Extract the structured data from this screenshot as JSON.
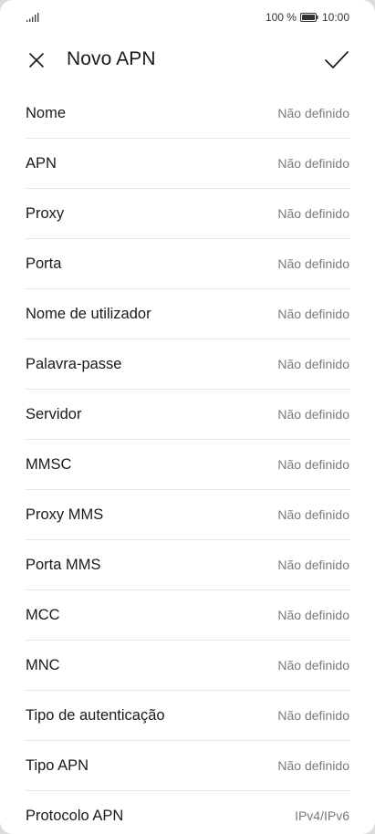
{
  "status_bar": {
    "battery_percent": "100 %",
    "time": "10:00"
  },
  "header": {
    "title": "Novo APN"
  },
  "fields": [
    {
      "label": "Nome",
      "value": "Não definido"
    },
    {
      "label": "APN",
      "value": "Não definido"
    },
    {
      "label": "Proxy",
      "value": "Não definido"
    },
    {
      "label": "Porta",
      "value": "Não definido"
    },
    {
      "label": "Nome de utilizador",
      "value": "Não definido"
    },
    {
      "label": "Palavra-passe",
      "value": "Não definido"
    },
    {
      "label": "Servidor",
      "value": "Não definido"
    },
    {
      "label": "MMSC",
      "value": "Não definido"
    },
    {
      "label": "Proxy MMS",
      "value": "Não definido"
    },
    {
      "label": "Porta MMS",
      "value": "Não definido"
    },
    {
      "label": "MCC",
      "value": "Não definido"
    },
    {
      "label": "MNC",
      "value": "Não definido"
    },
    {
      "label": "Tipo de autenticação",
      "value": "Não definido"
    },
    {
      "label": "Tipo APN",
      "value": "Não definido"
    },
    {
      "label": "Protocolo APN",
      "value": "IPv4/IPv6"
    }
  ]
}
